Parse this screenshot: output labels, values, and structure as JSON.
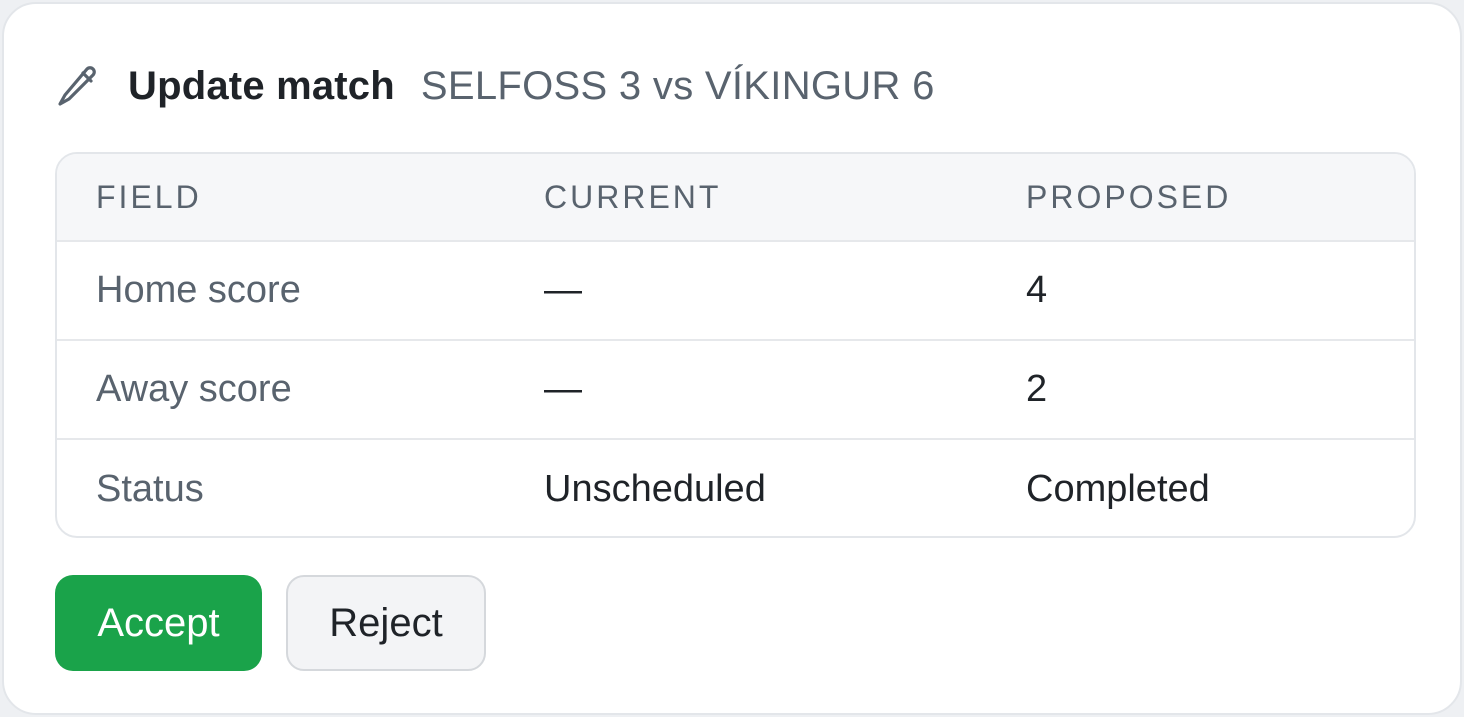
{
  "header": {
    "icon": "pencil-icon",
    "title": "Update match",
    "subtitle": "SELFOSS 3 vs VÍKINGUR 6"
  },
  "table": {
    "columns": [
      "FIELD",
      "CURRENT",
      "PROPOSED"
    ],
    "rows": [
      {
        "field": "Home score",
        "current": "—",
        "proposed": "4"
      },
      {
        "field": "Away score",
        "current": "—",
        "proposed": "2"
      },
      {
        "field": "Status",
        "current": "Unscheduled",
        "proposed": "Completed"
      }
    ]
  },
  "actions": {
    "accept_label": "Accept",
    "reject_label": "Reject"
  },
  "colors": {
    "accept": "#1aa34a",
    "text_primary": "#1f2328",
    "text_muted": "#59636e"
  }
}
